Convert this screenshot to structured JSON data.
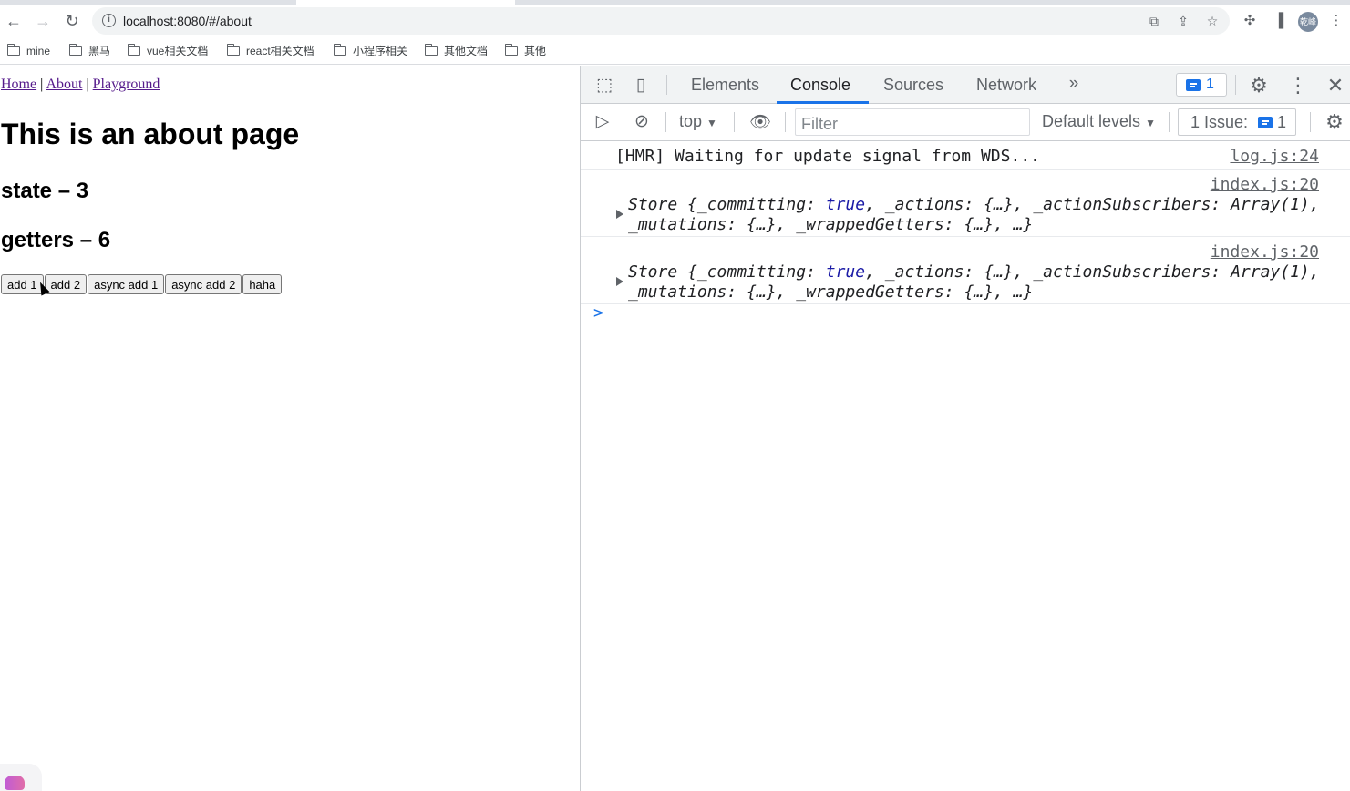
{
  "browser": {
    "url": "localhost:8080/#/about",
    "bookmarks": [
      "mine",
      "黑马",
      "vue相关文档",
      "react相关文档",
      "小程序相关",
      "其他文档",
      "其他"
    ],
    "avatar_text": "乾峰"
  },
  "page": {
    "nav": {
      "home": "Home",
      "about": "About",
      "playground": "Playground",
      "separator": "|"
    },
    "title": "This is an about page",
    "state_text": "state – 3",
    "getters_text": "getters – 6",
    "buttons": [
      "add 1",
      "add 2",
      "async add 1",
      "async add 2",
      "haha"
    ]
  },
  "devtools": {
    "tabs": [
      "Elements",
      "Console",
      "Sources",
      "Network"
    ],
    "active_tab": "Console",
    "message_count": "1",
    "context": "top",
    "filter_placeholder": "Filter",
    "levels": "Default levels",
    "issues_label": "1 Issue:",
    "issues_count": "1",
    "console_rows": [
      {
        "text": "[HMR] Waiting for update signal from WDS...",
        "source": "log.js:24"
      },
      {
        "source": "index.js:20",
        "line1_prefix": "Store {_committing: ",
        "line1_kw": "true",
        "line1_suffix": ", _actions: {…}, _actionSubscribers: Array(1),",
        "line2": "_mutations: {…}, _wrappedGetters: {…}, …}"
      },
      {
        "source": "index.js:20",
        "line1_prefix": "Store {_committing: ",
        "line1_kw": "true",
        "line1_suffix": ", _actions: {…}, _actionSubscribers: Array(1),",
        "line2": "_mutations: {…}, _wrappedGetters: {…}, …}"
      }
    ],
    "prompt": ">"
  }
}
